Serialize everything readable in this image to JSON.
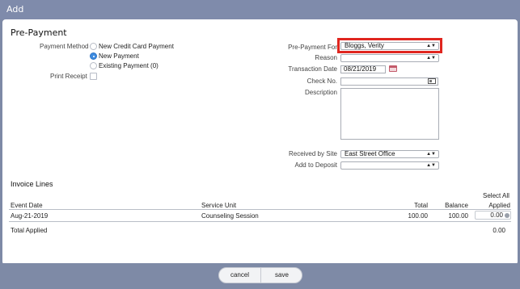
{
  "window": {
    "title": "Add"
  },
  "form": {
    "heading": "Pre-Payment",
    "payment_method_label": "Payment Method",
    "payment_options": [
      "New Credit Card Payment",
      "New Payment",
      "Existing Payment (0)"
    ],
    "selected_option": "New Payment",
    "print_receipt_label": "Print Receipt",
    "prepayment_for_label": "Pre-Payment For",
    "prepayment_for_value": "Bloggs, Verity",
    "reason_label": "Reason",
    "reason_value": "",
    "transaction_date_label": "Transaction Date",
    "transaction_date_value": "08/21/2019",
    "check_no_label": "Check No.",
    "check_no_value": "",
    "description_label": "Description",
    "received_by_site_label": "Received by Site",
    "received_by_site_value": "East Street Office",
    "add_to_deposit_label": "Add to Deposit",
    "add_to_deposit_value": ""
  },
  "invoice": {
    "heading": "Invoice Lines",
    "select_all_label": "Select All",
    "columns": {
      "event_date": "Event Date",
      "service_unit": "Service Unit",
      "total": "Total",
      "balance": "Balance",
      "applied": "Applied"
    },
    "rows": [
      {
        "event_date": "Aug-21-2019",
        "service_unit": "Counseling Session",
        "total": "100.00",
        "balance": "100.00",
        "applied": "0.00"
      }
    ],
    "total_applied_label": "Total Applied",
    "total_applied_value": "0.00"
  },
  "buttons": {
    "cancel": "cancel",
    "save": "save"
  },
  "colors": {
    "titlebar": "#7f8bab",
    "highlight": "#e0261f",
    "radio_selected": "#3d8be0"
  }
}
